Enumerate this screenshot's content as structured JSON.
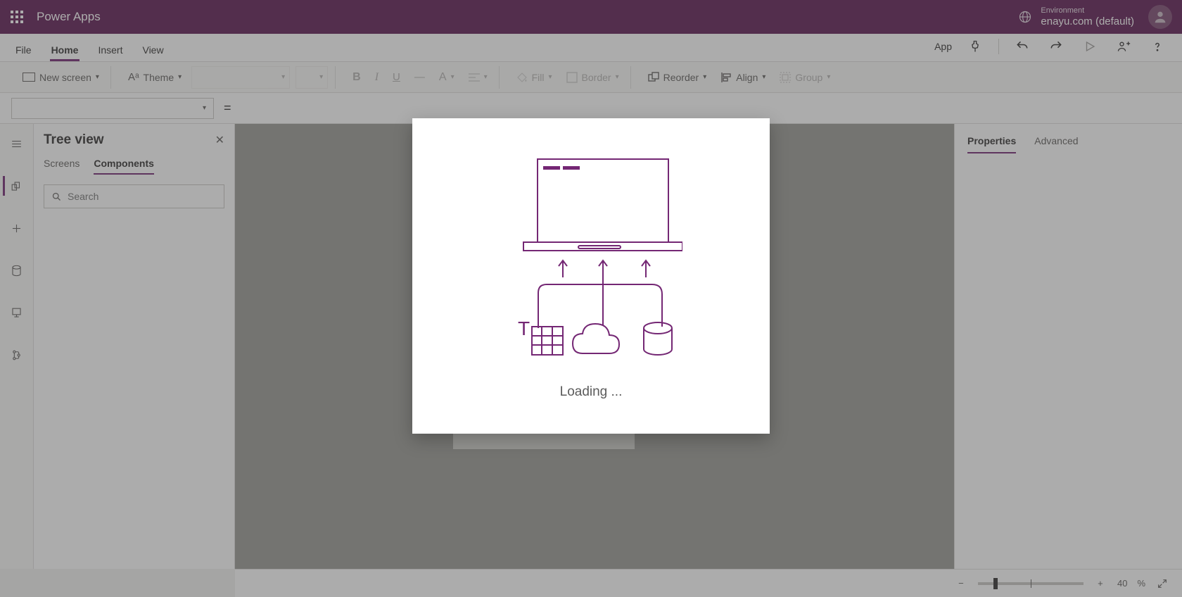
{
  "topbar": {
    "app_title": "Power Apps",
    "env_label": "Environment",
    "env_value": "enayu.com (default)"
  },
  "menu": {
    "items": [
      "File",
      "Home",
      "Insert",
      "View"
    ],
    "active": "Home",
    "app_btn": "App"
  },
  "ribbon": {
    "new_screen": "New screen",
    "theme": "Theme",
    "fill": "Fill",
    "border": "Border",
    "reorder": "Reorder",
    "align": "Align",
    "group": "Group"
  },
  "formula": {
    "eq": "="
  },
  "tree": {
    "title": "Tree view",
    "tab_screens": "Screens",
    "tab_components": "Components",
    "search_placeholder": "Search"
  },
  "props": {
    "tab_properties": "Properties",
    "tab_advanced": "Advanced"
  },
  "status": {
    "zoom_value": "40",
    "zoom_unit": "%"
  },
  "modal": {
    "text": "Loading ..."
  }
}
